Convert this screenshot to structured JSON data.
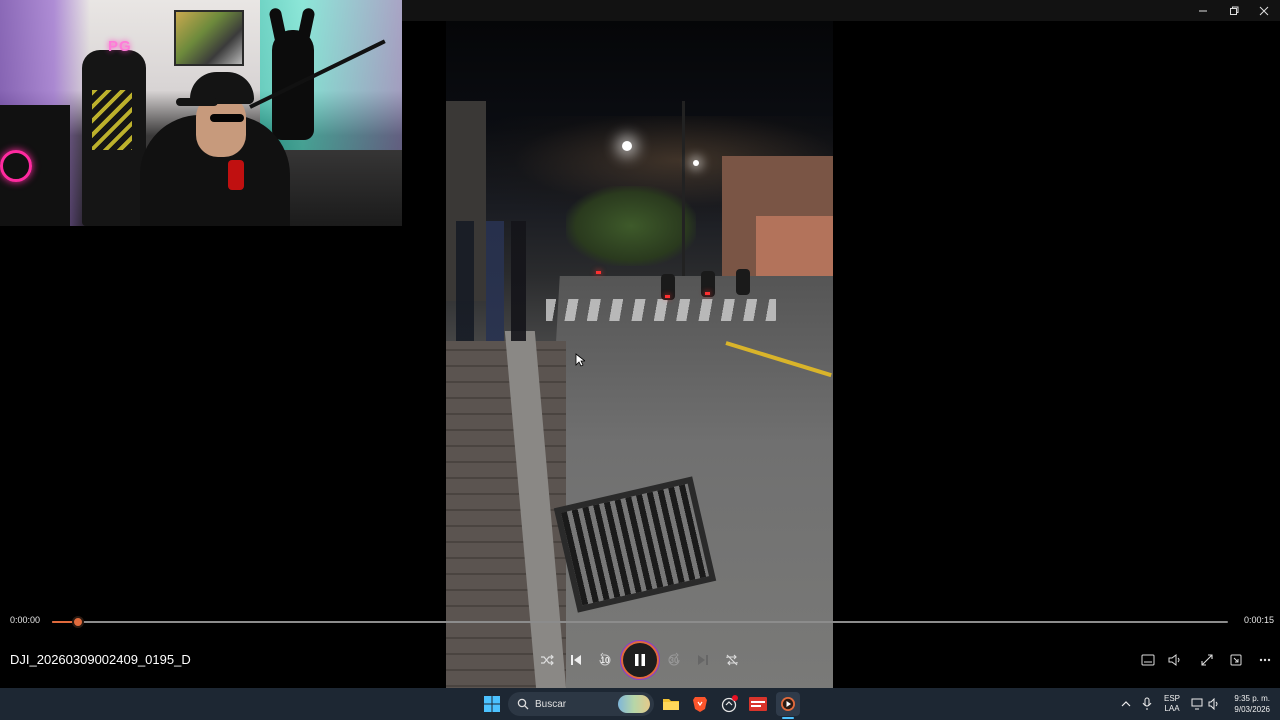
{
  "player": {
    "file_name": "DJI_20260309002409_0195_D",
    "time_current": "0:00:00",
    "time_total": "0:00:15",
    "progress": 0.022,
    "accent_color": "#e06a3c",
    "controls": {
      "replay_seconds": "10",
      "forward_seconds": "30",
      "icons": [
        "shuffle-icon",
        "previous-icon",
        "replay-10-icon",
        "pause-icon",
        "forward-30-icon",
        "next-icon",
        "repeat-off-icon"
      ]
    },
    "right_controls": [
      "subtitles-icon",
      "volume-icon",
      "fullscreen-icon",
      "miniplayer-icon",
      "more-icon"
    ]
  },
  "webcam": {
    "neon_sign": "PG"
  },
  "taskbar": {
    "search_placeholder": "Buscar",
    "language_line1": "ESP",
    "language_line2": "LAA",
    "time": "9:35 p. m.",
    "date": "9/03/2026",
    "apps": [
      "start-icon",
      "search-icon",
      "weather-icon",
      "file-explorer-icon",
      "brave-icon",
      "app-icon",
      "voicemeeter-icon",
      "media-player-icon"
    ]
  }
}
